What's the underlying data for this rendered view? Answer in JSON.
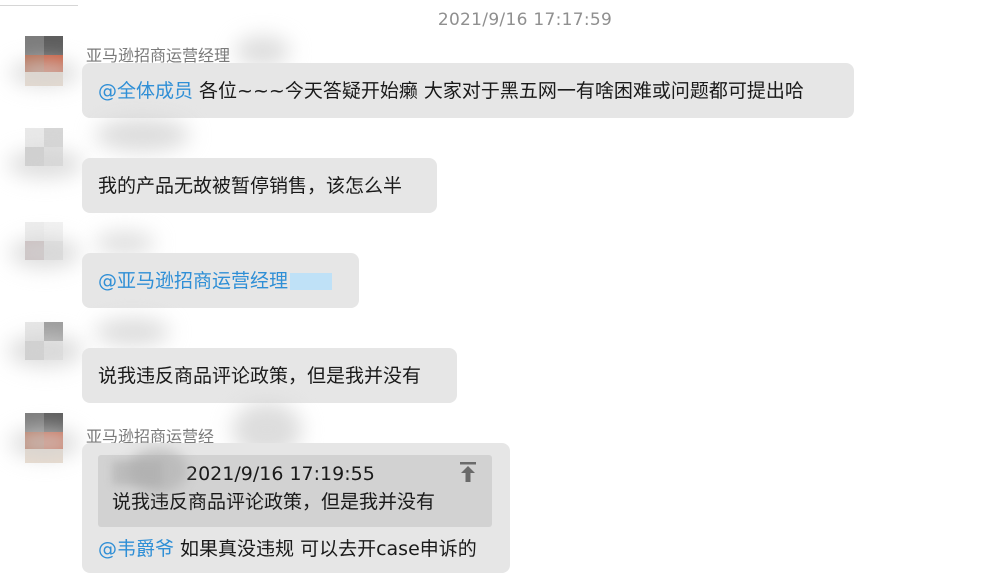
{
  "chat": {
    "timestamp": "2021/9/16 17:17:59",
    "messages": [
      {
        "sender": "亚马逊招商运营经理",
        "mention": "@全体成员",
        "text": " 各位~~~今天答疑开始癞 大家对于黑五网一有啥困难或问题都可提出哈"
      },
      {
        "text": "我的产品无故被暂停销售，该怎么半"
      },
      {
        "mention": "@亚马逊招商运营经理"
      },
      {
        "text": "说我违反商品评论政策，但是我并没有"
      },
      {
        "sender": "亚马逊招商运营经",
        "quote": {
          "time": "2021/9/16 17:19:55",
          "text": "说我违反商品评论政策，但是我并没有"
        },
        "mention": "@韦爵爷",
        "text": " 如果真没违规 可以去开case申诉的"
      }
    ]
  },
  "icons": {
    "pin": "pin-to-top-icon"
  },
  "colors": {
    "mention": "#2f8fd6",
    "bubble": "#e6e6e6",
    "quote": "#d2d2d2"
  }
}
